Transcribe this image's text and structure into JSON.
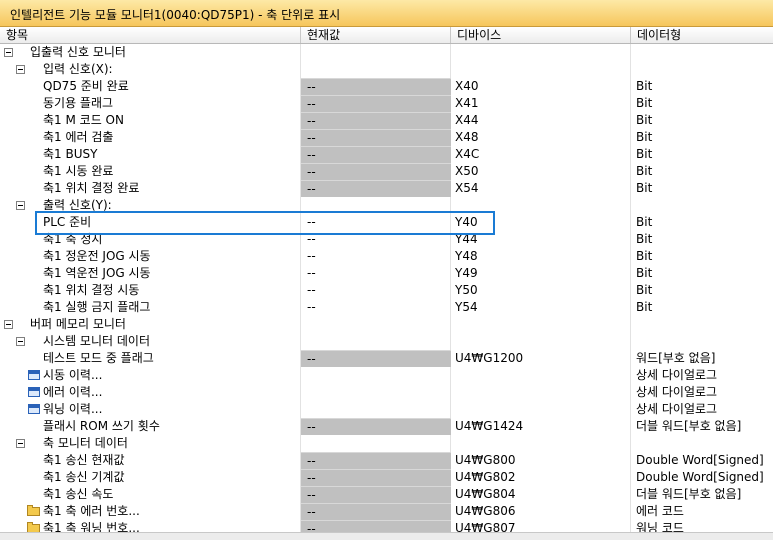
{
  "window": {
    "title": "인텔리전트 기능 모듈 모니터1(0040:QD75P1) - 축 단위로 표시"
  },
  "columns": {
    "item": "항목",
    "value": "현재값",
    "device": "디바이스",
    "dtype": "데이터형"
  },
  "rows": [
    {
      "name": "입출력 신호 모니터",
      "value": "",
      "device": "",
      "dtype": ""
    },
    {
      "name": "입력 신호(X):",
      "value": "",
      "device": "",
      "dtype": ""
    },
    {
      "name": "QD75 준비 완료",
      "value": "--",
      "device": "X40",
      "dtype": "Bit"
    },
    {
      "name": "동기용 플래그",
      "value": "--",
      "device": "X41",
      "dtype": "Bit"
    },
    {
      "name": "축1 M 코드 ON",
      "value": "--",
      "device": "X44",
      "dtype": "Bit"
    },
    {
      "name": "축1 에러 검출",
      "value": "--",
      "device": "X48",
      "dtype": "Bit"
    },
    {
      "name": "축1 BUSY",
      "value": "--",
      "device": "X4C",
      "dtype": "Bit"
    },
    {
      "name": "축1 시동 완료",
      "value": "--",
      "device": "X50",
      "dtype": "Bit"
    },
    {
      "name": "축1 위치 결정 완료",
      "value": "--",
      "device": "X54",
      "dtype": "Bit"
    },
    {
      "name": "출력 신호(Y):",
      "value": "",
      "device": "",
      "dtype": ""
    },
    {
      "name": "PLC 준비",
      "value": "--",
      "device": "Y40",
      "dtype": "Bit"
    },
    {
      "name": "축1 축 정지",
      "value": "--",
      "device": "Y44",
      "dtype": "Bit"
    },
    {
      "name": "축1 정운전 JOG 시동",
      "value": "--",
      "device": "Y48",
      "dtype": "Bit"
    },
    {
      "name": "축1 역운전 JOG 시동",
      "value": "--",
      "device": "Y49",
      "dtype": "Bit"
    },
    {
      "name": "축1 위치 결정 시동",
      "value": "--",
      "device": "Y50",
      "dtype": "Bit"
    },
    {
      "name": "축1 실행 금지 플래그",
      "value": "--",
      "device": "Y54",
      "dtype": "Bit"
    },
    {
      "name": "버퍼 메모리 모니터",
      "value": "",
      "device": "",
      "dtype": ""
    },
    {
      "name": "시스템 모니터 데이터",
      "value": "",
      "device": "",
      "dtype": ""
    },
    {
      "name": "테스트 모드 중 플래그",
      "value": "--",
      "device": "U4₩G1200",
      "dtype": "워드[부호 없음]"
    },
    {
      "name": "시동 이력...",
      "value": "",
      "device": "",
      "dtype": "상세 다이얼로그"
    },
    {
      "name": "에러 이력...",
      "value": "",
      "device": "",
      "dtype": "상세 다이얼로그"
    },
    {
      "name": "워닝 이력...",
      "value": "",
      "device": "",
      "dtype": "상세 다이얼로그"
    },
    {
      "name": "플래시 ROM 쓰기 횟수",
      "value": "--",
      "device": "U4₩G1424",
      "dtype": "더블 워드[부호 없음]"
    },
    {
      "name": "축 모니터 데이터",
      "value": "",
      "device": "",
      "dtype": ""
    },
    {
      "name": "축1 송신 현재값",
      "value": "--",
      "device": "U4₩G800",
      "dtype": "Double Word[Signed]"
    },
    {
      "name": "축1 송신 기계값",
      "value": "--",
      "device": "U4₩G802",
      "dtype": "Double Word[Signed]"
    },
    {
      "name": "축1 송신 속도",
      "value": "--",
      "device": "U4₩G804",
      "dtype": "더블 워드[부호 없음]"
    },
    {
      "name": "축1 축 에러 번호...",
      "value": "--",
      "device": "U4₩G806",
      "dtype": "에러 코드"
    },
    {
      "name": "축1 축 워닝 번호...",
      "value": "--",
      "device": "U4₩G807",
      "dtype": "워닝 코드"
    }
  ]
}
